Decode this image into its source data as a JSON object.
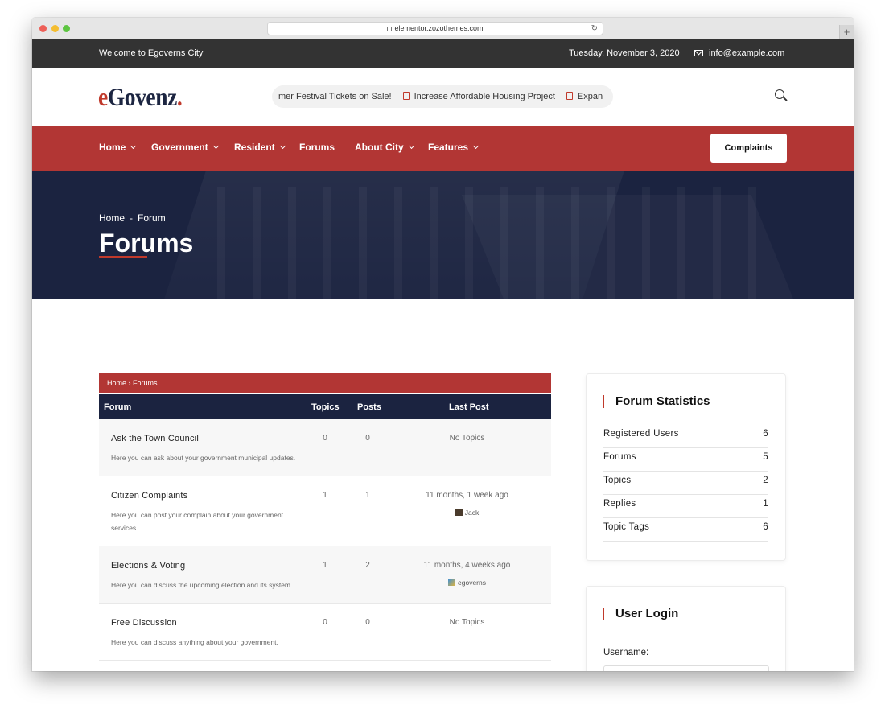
{
  "browser": {
    "url": "elementor.zozothemes.com"
  },
  "topbar": {
    "welcome": "Welcome to Egoverns City",
    "date": "Tuesday, November 3, 2020",
    "email": "info@example.com"
  },
  "header": {
    "logo_e": "e",
    "logo_rest": "Govenz",
    "logo_dot": ".",
    "ticker": [
      "mer Festival Tickets on Sale!",
      "Increase Affordable Housing Project",
      "Expan"
    ]
  },
  "nav": {
    "items": [
      {
        "label": "Home"
      },
      {
        "label": "Government"
      },
      {
        "label": "Resident"
      },
      {
        "label": "Forums"
      },
      {
        "label": "About City"
      },
      {
        "label": "Features"
      }
    ],
    "cta": "Complaints"
  },
  "hero": {
    "crumb_home": "Home",
    "crumb_sep": "-",
    "crumb_current": "Forum",
    "title": "Forums"
  },
  "forum": {
    "breadcrumb": "Home › Forums",
    "headers": {
      "forum": "Forum",
      "topics": "Topics",
      "posts": "Posts",
      "last_post": "Last Post"
    },
    "rows": [
      {
        "title": "Ask the Town Council",
        "desc": "Here you can ask about your government municipal updates.",
        "topics": "0",
        "posts": "0",
        "last": "No Topics",
        "user": ""
      },
      {
        "title": "Citizen Complaints",
        "desc": "Here you can post your complain about your government services.",
        "topics": "1",
        "posts": "1",
        "last": "11 months, 1 week ago",
        "user": "Jack"
      },
      {
        "title": "Elections & Voting",
        "desc": "Here you can discuss the upcoming election and its system.",
        "topics": "1",
        "posts": "2",
        "last": "11 months, 4 weeks ago",
        "user": "egoverns"
      },
      {
        "title": "Free Discussion",
        "desc": "Here you can discuss anything about your government.",
        "topics": "0",
        "posts": "0",
        "last": "No Topics",
        "user": ""
      }
    ]
  },
  "sidebar": {
    "stats_title": "Forum Statistics",
    "stats": [
      {
        "label": "Registered Users",
        "value": "6"
      },
      {
        "label": "Forums",
        "value": "5"
      },
      {
        "label": "Topics",
        "value": "2"
      },
      {
        "label": "Replies",
        "value": "1"
      },
      {
        "label": "Topic Tags",
        "value": "6"
      }
    ],
    "login_title": "User Login",
    "username_label": "Username:"
  },
  "colors": {
    "brand_red": "#b23634",
    "navy": "#1b2340",
    "topbar": "#333333"
  }
}
